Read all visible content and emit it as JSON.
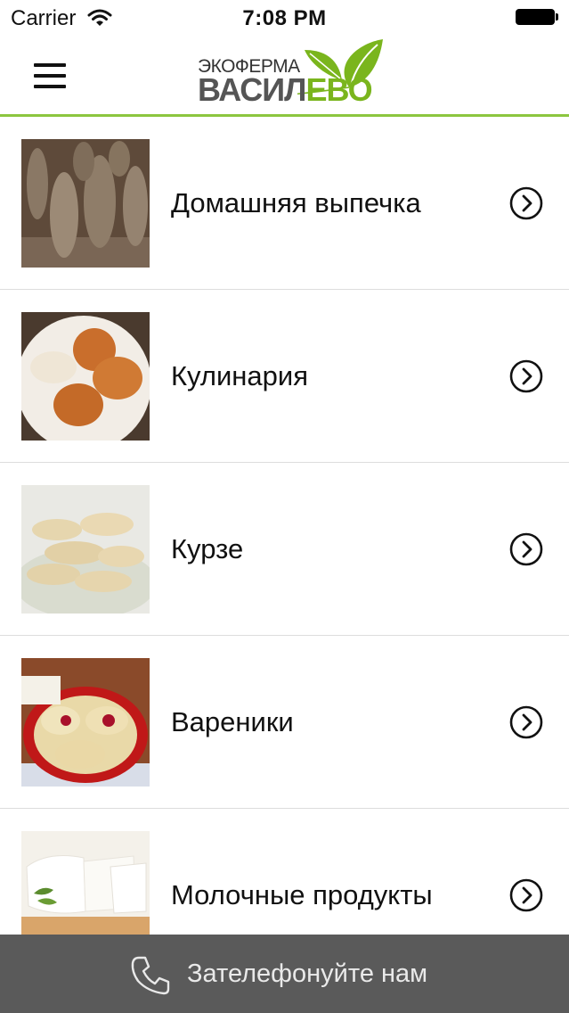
{
  "status": {
    "carrier": "Carrier",
    "time": "7:08 PM"
  },
  "header": {
    "logo_top": "ЭКОФЕРМА",
    "logo_main_a": "ВАСИЛ",
    "logo_main_b": "ЕВО",
    "accent": "#8cc63f"
  },
  "categories": [
    {
      "label": "Домашняя выпечка",
      "image": "homemade-bread-photo"
    },
    {
      "label": "Кулинария",
      "image": "cutlets-photo"
    },
    {
      "label": "Курзе",
      "image": "kurze-dumplings-photo"
    },
    {
      "label": "Вареники",
      "image": "cherry-vareniki-photo"
    },
    {
      "label": "Молочные продукты",
      "image": "cheese-photo"
    }
  ],
  "footer": {
    "call_label": "Зателефонуйте нам",
    "background": "#5a5a5a"
  }
}
